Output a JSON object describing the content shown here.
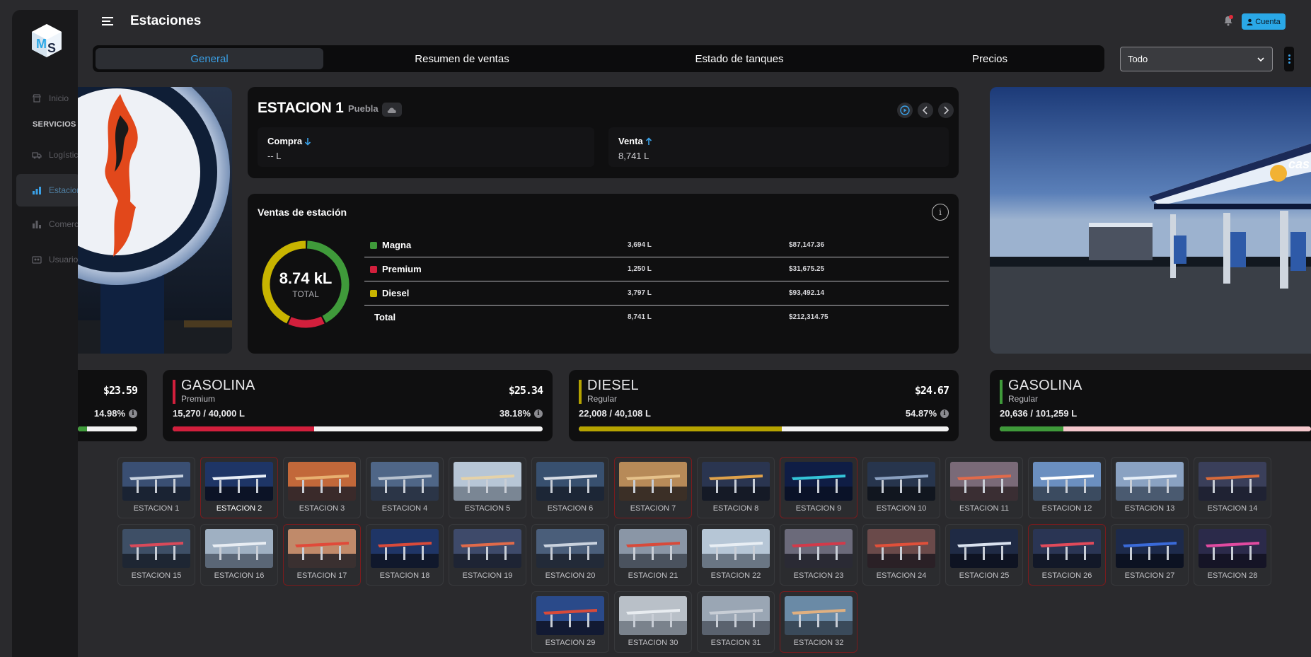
{
  "header": {
    "title": "Estaciones",
    "account_label": "Cuenta"
  },
  "sidebar": {
    "items": [
      {
        "label": "Inicio",
        "icon": "store-icon"
      },
      {
        "label": "Logística",
        "icon": "truck-icon"
      },
      {
        "label": "Estaciones",
        "icon": "chart-icon",
        "active": true
      },
      {
        "label": "Comercial",
        "icon": "bar-chart-icon"
      },
      {
        "label": "Usuarios",
        "icon": "users-icon"
      }
    ],
    "section_label": "SERVICIOS"
  },
  "tabs": [
    {
      "label": "General",
      "active": true
    },
    {
      "label": "Resumen de ventas"
    },
    {
      "label": "Estado de tanques"
    },
    {
      "label": "Precios"
    }
  ],
  "filter": {
    "selected": "Todo"
  },
  "station": {
    "name": "ESTACION 1",
    "city": "Puebla",
    "compra_label": "Compra",
    "compra_value": "-- L",
    "venta_label": "Venta",
    "venta_value": "8,741 L"
  },
  "sales": {
    "title": "Ventas de estación",
    "donut_value": "8.74 kL",
    "donut_label": "TOTAL",
    "rows": [
      {
        "name": "Magna",
        "liters": "3,694 L",
        "amount": "$87,147.36",
        "color": "#3f9a3a",
        "share": 0.4226
      },
      {
        "name": "Premium",
        "liters": "1,250 L",
        "amount": "$31,675.25",
        "color": "#d21f3c",
        "share": 0.143
      },
      {
        "name": "Diesel",
        "liters": "3,797 L",
        "amount": "$93,492.14",
        "color": "#c8b400",
        "share": 0.4344
      },
      {
        "name": "Total",
        "liters": "8,741 L",
        "amount": "$212,314.75"
      }
    ]
  },
  "fuels": [
    {
      "name": "",
      "sub": "",
      "price": "$23.59",
      "capacity": "",
      "percent": "14.98%",
      "color": "#3f9a3a",
      "fill": 0.1498
    },
    {
      "name": "GASOLINA",
      "sub": "Premium",
      "price": "$25.34",
      "capacity": "15,270 / 40,000 L",
      "percent": "38.18%",
      "color": "#d21f3c",
      "fill": 0.3818
    },
    {
      "name": "DIESEL",
      "sub": "Regular",
      "price": "$24.67",
      "capacity": "22,008 / 40,108 L",
      "percent": "54.87%",
      "color": "#b5a300",
      "fill": 0.5487
    },
    {
      "name": "GASOLINA",
      "sub": "Regular",
      "capacity": "20,636 / 101,259 L",
      "color": "#3f9a3a",
      "fill": 0.2038
    }
  ],
  "stations": [
    "ESTACION 1",
    "ESTACION 2",
    "ESTACION 3",
    "ESTACION 4",
    "ESTACION 5",
    "ESTACION 6",
    "ESTACION 7",
    "ESTACION 8",
    "ESTACION 9",
    "ESTACION 10",
    "ESTACION 11",
    "ESTACION 12",
    "ESTACION 13",
    "ESTACION 14",
    "ESTACION 15",
    "ESTACION 16",
    "ESTACION 17",
    "ESTACION 18",
    "ESTACION 19",
    "ESTACION 20",
    "ESTACION 21",
    "ESTACION 22",
    "ESTACION 23",
    "ESTACION 24",
    "ESTACION 25",
    "ESTACION 26",
    "ESTACION 27",
    "ESTACION 28",
    "ESTACION 29",
    "ESTACION 30",
    "ESTACION 31",
    "ESTACION 32"
  ],
  "colors": {
    "accent": "#3aa0e6",
    "magna": "#3f9a3a",
    "premium": "#d21f3c",
    "diesel": "#c8b400"
  }
}
